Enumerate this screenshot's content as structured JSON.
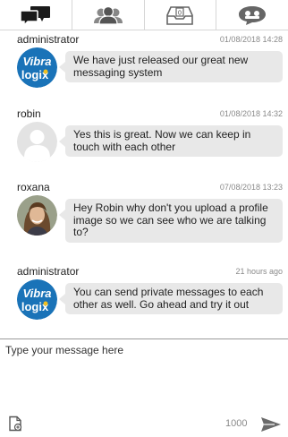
{
  "tabs": [
    {
      "id": "conversations",
      "icon": "chat-bubbles-icon",
      "active": true
    },
    {
      "id": "users",
      "icon": "users-icon",
      "active": false
    },
    {
      "id": "inbox",
      "icon": "inbox-count-icon",
      "active": false,
      "badge": "0"
    },
    {
      "id": "private",
      "icon": "private-chat-icon",
      "active": false
    }
  ],
  "messages": [
    {
      "author": "administrator",
      "time": "01/08/2018 14:28",
      "text": "We have just released our great new messaging system",
      "avatar": "vibralogix-logo"
    },
    {
      "author": "robin",
      "time": "01/08/2018 14:32",
      "text": "Yes this is great. Now we can keep in touch with each other",
      "avatar": "default-user"
    },
    {
      "author": "roxana",
      "time": "07/08/2018 13:23",
      "text": "Hey Robin why don't you upload a profile image so we can see who we are talking to?",
      "avatar": "user-photo"
    },
    {
      "author": "administrator",
      "time": "21 hours ago",
      "text": "You can send private messages to each other as well. Go ahead and try it out",
      "avatar": "vibralogix-logo"
    }
  ],
  "logo": {
    "line1": "Vibra",
    "line2_a": "log",
    "line2_b": "ix"
  },
  "composer": {
    "placeholder": "Type your message here",
    "char_count": "1000"
  },
  "colors": {
    "logo_blue": "#1a73b8",
    "logo_yellow": "#f0c020",
    "bubble": "#e8e8e8",
    "icon_dark": "#1a1a1a"
  }
}
